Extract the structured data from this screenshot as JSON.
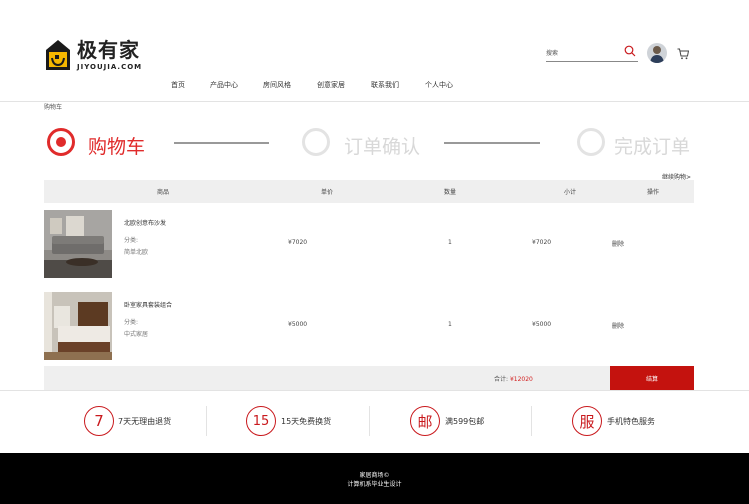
{
  "brand": {
    "name_cn": "极有家",
    "name_en": "JIYOUJIA.COM",
    "accent": "#e02b2b",
    "logo_mark_color": "#f5b700"
  },
  "search": {
    "placeholder": "搜索"
  },
  "nav": [
    {
      "label": "首页"
    },
    {
      "label": "产品中心"
    },
    {
      "label": "房间风格"
    },
    {
      "label": "创意家居"
    },
    {
      "label": "联系我们"
    },
    {
      "label": "个人中心"
    }
  ],
  "breadcrumb": "购物车",
  "steps": [
    {
      "label": "购物车",
      "active": true
    },
    {
      "label": "订单确认",
      "active": false
    },
    {
      "label": "完成订单",
      "active": false
    }
  ],
  "continue_label": "继续购物>",
  "table": {
    "headers": [
      "商品",
      "单价",
      "数量",
      "小计",
      "操作"
    ],
    "rows": [
      {
        "name": "北欧创意布沙发",
        "cat_label": "分类:",
        "cat_value": "简单北欧",
        "price": "¥7020",
        "qty": "1",
        "subtotal": "¥7020",
        "action": "删除"
      },
      {
        "name": "卧室家具套装组合",
        "cat_label": "分类:",
        "cat_value": "中式家居",
        "price": "¥5000",
        "qty": "1",
        "subtotal": "¥5000",
        "action": "删除"
      }
    ]
  },
  "total": {
    "label": "合计:",
    "amount": "¥12020"
  },
  "checkout_label": "结算",
  "features": [
    {
      "icon": "7",
      "text": "7天无理由退货"
    },
    {
      "icon": "15",
      "text": "15天免费换货"
    },
    {
      "icon": "邮",
      "text": "满599包邮"
    },
    {
      "icon": "服",
      "text": "手机特色服务"
    }
  ],
  "footer": {
    "line1": "家居商场©",
    "line2": "计算机系毕业生设计"
  }
}
